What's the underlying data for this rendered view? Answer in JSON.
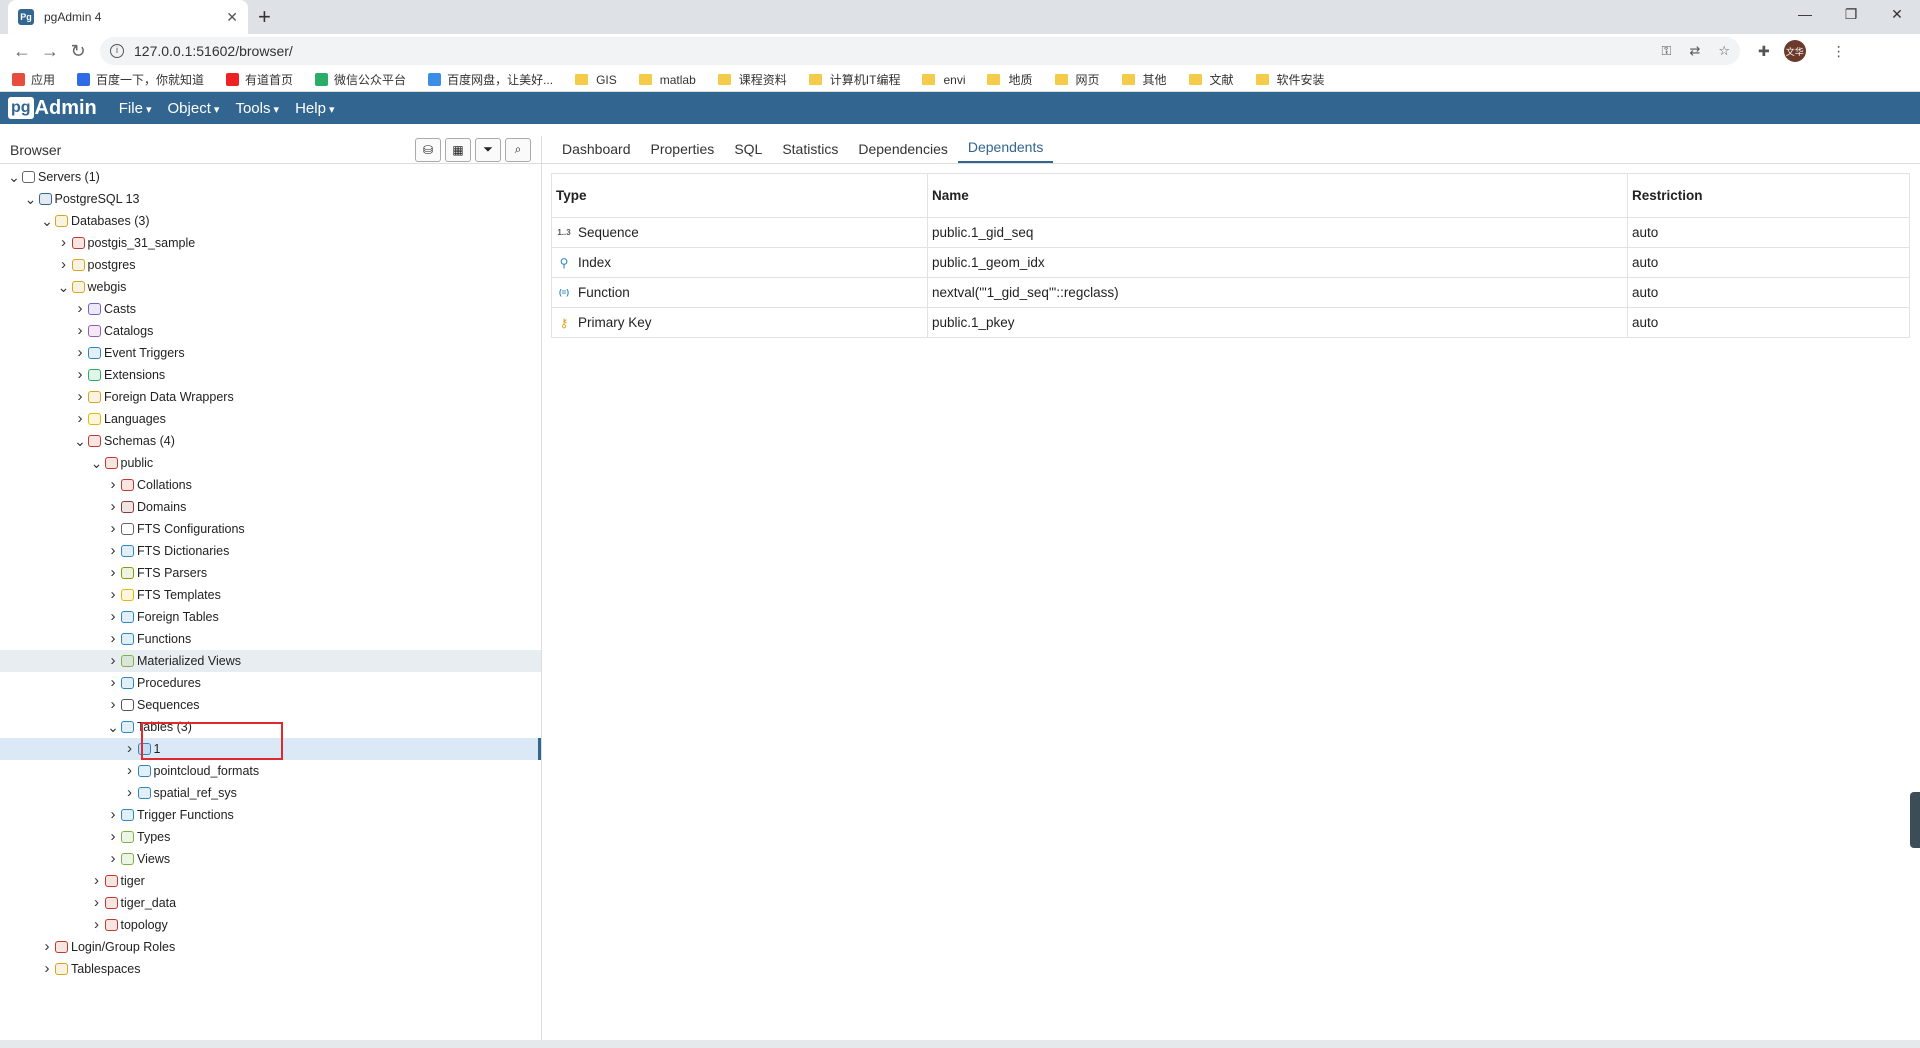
{
  "browser": {
    "tab_title": "pgAdmin 4",
    "tab_favicon": "Pg",
    "new_tab": "+",
    "url": "127.0.0.1:51602/browser/",
    "avatar_text": "文华",
    "bookmarks": [
      {
        "label": "应用",
        "kind": "apps"
      },
      {
        "label": "百度一下，你就知道",
        "kind": "baidu"
      },
      {
        "label": "有道首页",
        "kind": "youdao"
      },
      {
        "label": "微信公众平台",
        "kind": "wechat"
      },
      {
        "label": "百度网盘，让美好...",
        "kind": "pan"
      },
      {
        "label": "GIS",
        "kind": "folder"
      },
      {
        "label": "matlab",
        "kind": "folder"
      },
      {
        "label": "课程资料",
        "kind": "folder"
      },
      {
        "label": "计算机IT编程",
        "kind": "folder"
      },
      {
        "label": "envi",
        "kind": "folder"
      },
      {
        "label": "地质",
        "kind": "folder"
      },
      {
        "label": "网页",
        "kind": "folder"
      },
      {
        "label": "其他",
        "kind": "folder"
      },
      {
        "label": "文献",
        "kind": "folder"
      },
      {
        "label": "软件安装",
        "kind": "folder"
      }
    ]
  },
  "app": {
    "logo_pg": "pg",
    "logo_admin": "Admin",
    "menus": [
      "File",
      "Object",
      "Tools",
      "Help"
    ]
  },
  "browser_panel": {
    "title": "Browser",
    "tree": [
      {
        "label": "Servers (1)",
        "level": 0,
        "open": true,
        "icon": "servers-icon",
        "color": "#666"
      },
      {
        "label": "PostgreSQL 13",
        "level": 1,
        "open": true,
        "icon": "postgresql-icon",
        "color": "#336791"
      },
      {
        "label": "Databases (3)",
        "level": 2,
        "open": true,
        "icon": "databases-icon",
        "color": "#d9a520"
      },
      {
        "label": "postgis_31_sample",
        "level": 3,
        "open": false,
        "icon": "database-icon",
        "color": "#c0392b"
      },
      {
        "label": "postgres",
        "level": 3,
        "open": false,
        "icon": "database-icon",
        "color": "#d9a520"
      },
      {
        "label": "webgis",
        "level": 3,
        "open": true,
        "icon": "database-icon",
        "color": "#d9a520"
      },
      {
        "label": "Casts",
        "level": 4,
        "open": false,
        "icon": "casts-icon",
        "color": "#7a5fc0"
      },
      {
        "label": "Catalogs",
        "level": 4,
        "open": false,
        "icon": "catalogs-icon",
        "color": "#9b59b6"
      },
      {
        "label": "Event Triggers",
        "level": 4,
        "open": false,
        "icon": "event-triggers-icon",
        "color": "#2e86c1"
      },
      {
        "label": "Extensions",
        "level": 4,
        "open": false,
        "icon": "extensions-icon",
        "color": "#27ae60"
      },
      {
        "label": "Foreign Data Wrappers",
        "level": 4,
        "open": false,
        "icon": "fdw-icon",
        "color": "#d9a520"
      },
      {
        "label": "Languages",
        "level": 4,
        "open": false,
        "icon": "languages-icon",
        "color": "#e6b800"
      },
      {
        "label": "Schemas (4)",
        "level": 4,
        "open": true,
        "icon": "schemas-icon",
        "color": "#c0392b"
      },
      {
        "label": "public",
        "level": 5,
        "open": true,
        "icon": "schema-icon",
        "color": "#c0392b"
      },
      {
        "label": "Collations",
        "level": 6,
        "open": false,
        "icon": "collations-icon",
        "color": "#c0392b"
      },
      {
        "label": "Domains",
        "level": 6,
        "open": false,
        "icon": "domains-icon",
        "color": "#8e3b2e"
      },
      {
        "label": "FTS Configurations",
        "level": 6,
        "open": false,
        "icon": "fts-config-icon",
        "color": "#666"
      },
      {
        "label": "FTS Dictionaries",
        "level": 6,
        "open": false,
        "icon": "fts-dict-icon",
        "color": "#2e86c1"
      },
      {
        "label": "FTS Parsers",
        "level": 6,
        "open": false,
        "icon": "fts-parsers-icon",
        "color": "#7d9f0a"
      },
      {
        "label": "FTS Templates",
        "level": 6,
        "open": false,
        "icon": "fts-templates-icon",
        "color": "#e6b800"
      },
      {
        "label": "Foreign Tables",
        "level": 6,
        "open": false,
        "icon": "foreign-tables-icon",
        "color": "#2e86c1"
      },
      {
        "label": "Functions",
        "level": 6,
        "open": false,
        "icon": "functions-icon",
        "color": "#2e86c1"
      },
      {
        "label": "Materialized Views",
        "level": 6,
        "open": false,
        "icon": "mat-views-icon",
        "color": "#7cb342",
        "hl": true
      },
      {
        "label": "Procedures",
        "level": 6,
        "open": false,
        "icon": "procedures-icon",
        "color": "#2e86c1"
      },
      {
        "label": "Sequences",
        "level": 6,
        "open": false,
        "icon": "sequences-icon",
        "color": "#555"
      },
      {
        "label": "Tables (3)",
        "level": 6,
        "open": true,
        "icon": "tables-icon",
        "color": "#2e86c1"
      },
      {
        "label": "1",
        "level": 7,
        "open": false,
        "icon": "table-icon",
        "color": "#2e86c1",
        "sel": true
      },
      {
        "label": "pointcloud_formats",
        "level": 7,
        "open": false,
        "icon": "table-icon",
        "color": "#2e86c1"
      },
      {
        "label": "spatial_ref_sys",
        "level": 7,
        "open": false,
        "icon": "table-icon",
        "color": "#2e86c1"
      },
      {
        "label": "Trigger Functions",
        "level": 6,
        "open": false,
        "icon": "trigger-functions-icon",
        "color": "#2e86c1"
      },
      {
        "label": "Types",
        "level": 6,
        "open": false,
        "icon": "types-icon",
        "color": "#7cb342"
      },
      {
        "label": "Views",
        "level": 6,
        "open": false,
        "icon": "views-icon",
        "color": "#7cb342"
      },
      {
        "label": "tiger",
        "level": 5,
        "open": false,
        "icon": "schema-icon",
        "color": "#c0392b"
      },
      {
        "label": "tiger_data",
        "level": 5,
        "open": false,
        "icon": "schema-icon",
        "color": "#c0392b"
      },
      {
        "label": "topology",
        "level": 5,
        "open": false,
        "icon": "schema-icon",
        "color": "#c0392b"
      },
      {
        "label": "Login/Group Roles",
        "level": 2,
        "open": false,
        "icon": "roles-icon",
        "color": "#c0392b"
      },
      {
        "label": "Tablespaces",
        "level": 2,
        "open": false,
        "icon": "tablespaces-icon",
        "color": "#d9a520"
      }
    ]
  },
  "tabs": [
    "Dashboard",
    "Properties",
    "SQL",
    "Statistics",
    "Dependencies",
    "Dependents"
  ],
  "active_tab": "Dependents",
  "dependents": {
    "columns": [
      "Type",
      "Name",
      "Restriction"
    ],
    "rows": [
      {
        "type": "Sequence",
        "icon": "sequence-icon",
        "glyph": "1..3",
        "color": "#555",
        "name": "public.1_gid_seq",
        "restriction": "auto"
      },
      {
        "type": "Index",
        "icon": "index-icon",
        "glyph": "⚲",
        "color": "#2e86c1",
        "name": "public.1_geom_idx",
        "restriction": "auto"
      },
      {
        "type": "Function",
        "icon": "function-icon",
        "glyph": "(=)",
        "color": "#2e86c1",
        "name": "nextval('\"1_gid_seq\"'::regclass)",
        "restriction": "auto"
      },
      {
        "type": "Primary Key",
        "icon": "key-icon",
        "glyph": "⚷",
        "color": "#d9a520",
        "name": "public.1_pkey",
        "restriction": "auto"
      }
    ]
  }
}
